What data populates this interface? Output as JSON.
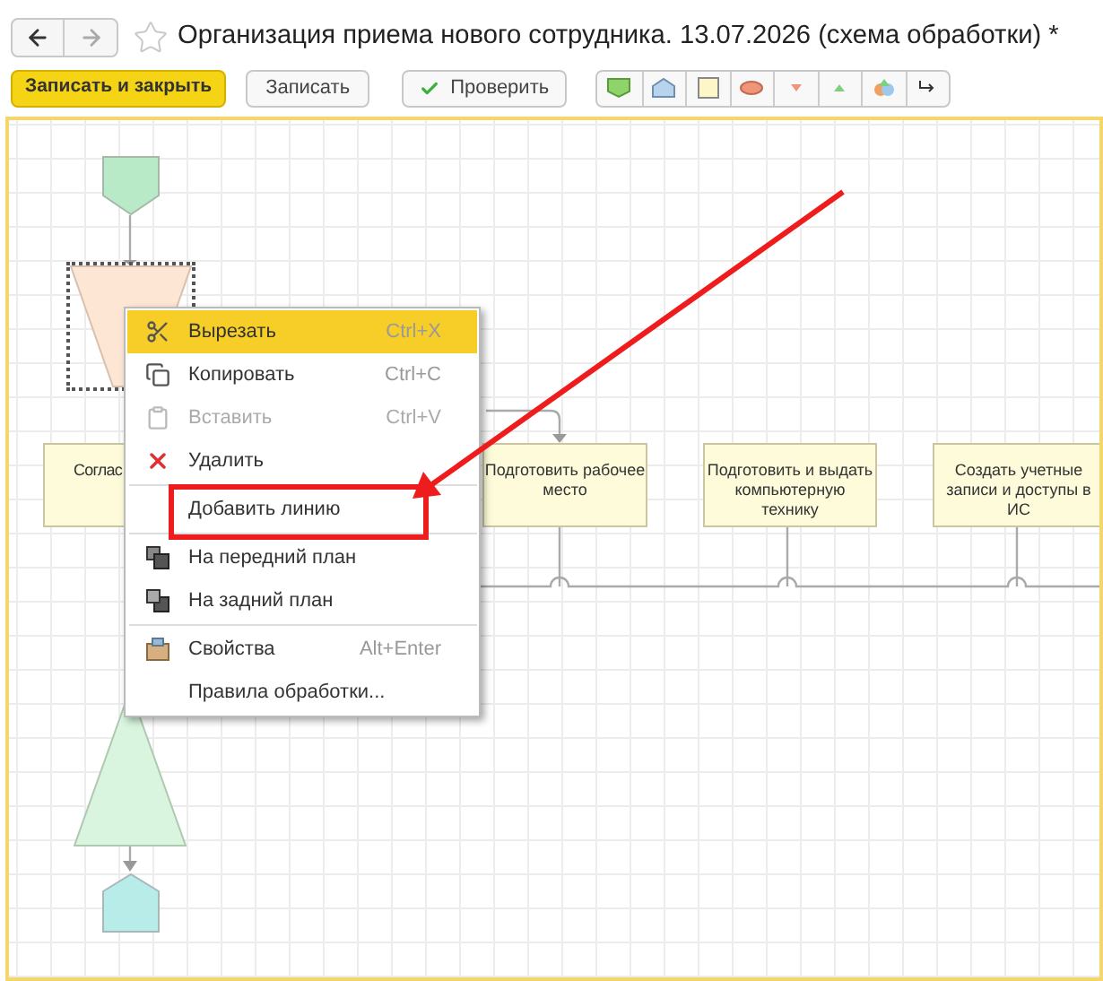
{
  "navigation": [
    {
      "kind": "back",
      "disabled": false
    },
    {
      "kind": "forward",
      "disabled": true
    }
  ],
  "favorite": false,
  "title": "Организация приема нового сотрудника. 13.07.2026 (схема обработки) *",
  "toolbar": [
    {
      "label": "Записать и закрыть",
      "kind": "primary"
    },
    {
      "label": "Записать",
      "kind": "plain"
    },
    {
      "label": "Проверить",
      "kind": "check"
    }
  ],
  "palette": [
    {
      "kind": "start"
    },
    {
      "kind": "point"
    },
    {
      "kind": "activity"
    },
    {
      "kind": "condition"
    },
    {
      "kind": "split"
    },
    {
      "kind": "merge"
    },
    {
      "kind": "nested"
    },
    {
      "kind": "connector"
    }
  ],
  "nodes": [
    {
      "kind": "start",
      "selected": false
    },
    {
      "kind": "split",
      "selected": true
    },
    {
      "kind": "activity",
      "text": "Соглас",
      "selected": false
    },
    {
      "kind": "activity",
      "text": "Подготовить рабочее место",
      "selected": false
    },
    {
      "kind": "activity",
      "text": "Подготовить и выдать компьютерную технику",
      "selected": false
    },
    {
      "kind": "activity",
      "text": "Создать учетные записи и доступы в ИС",
      "selected": false
    },
    {
      "kind": "merge",
      "selected": false
    },
    {
      "kind": "end",
      "selected": false
    }
  ],
  "context_menu": [
    {
      "kind": "item",
      "label": "Вырезать",
      "shortcut": "Ctrl+X",
      "selected": true,
      "disabled": false
    },
    {
      "kind": "item",
      "label": "Копировать",
      "shortcut": "Ctrl+C",
      "selected": false,
      "disabled": false
    },
    {
      "kind": "item",
      "label": "Вставить",
      "shortcut": "Ctrl+V",
      "selected": false,
      "disabled": true
    },
    {
      "kind": "item",
      "label": "Удалить",
      "selected": false,
      "disabled": false
    },
    {
      "kind": "separator"
    },
    {
      "kind": "item",
      "label": "Добавить линию",
      "selected": false,
      "disabled": false
    },
    {
      "kind": "separator"
    },
    {
      "kind": "item",
      "label": "На передний план",
      "selected": false,
      "disabled": false
    },
    {
      "kind": "item",
      "label": "На задний план",
      "selected": false,
      "disabled": false
    },
    {
      "kind": "separator"
    },
    {
      "kind": "item",
      "label": "Свойства",
      "shortcut": "Alt+Enter",
      "selected": false,
      "disabled": false
    },
    {
      "kind": "item",
      "label": "Правила обработки...",
      "selected": false,
      "disabled": false
    }
  ]
}
